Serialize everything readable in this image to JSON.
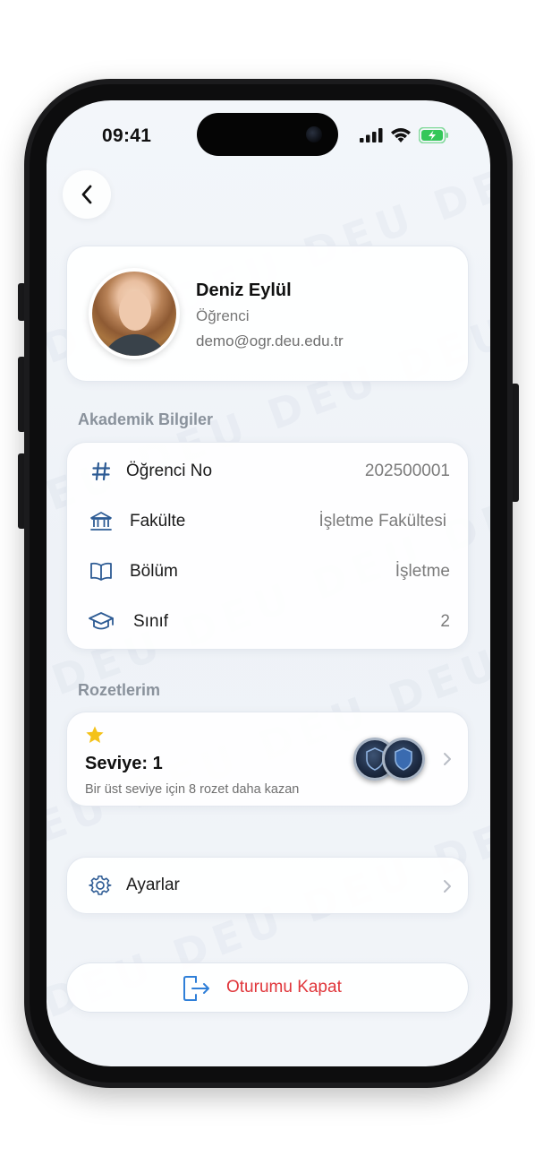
{
  "status_bar": {
    "time": "09:41"
  },
  "profile": {
    "name": "Deniz Eylül",
    "role": "Öğrenci",
    "email": "demo@ogr.deu.edu.tr"
  },
  "academic": {
    "section_title": "Akademik Bilgiler",
    "rows": [
      {
        "icon": "hash-icon",
        "label": "Öğrenci No",
        "value": "202500001"
      },
      {
        "icon": "bank-icon",
        "label": "Fakülte",
        "value": "İşletme Fakültesi"
      },
      {
        "icon": "book-icon",
        "label": "Bölüm",
        "value": "İşletme"
      },
      {
        "icon": "graduation-cap-icon",
        "label": "Sınıf",
        "value": "2"
      }
    ]
  },
  "badges": {
    "section_title": "Rozetlerim",
    "level": "Seviye: 1",
    "subtitle": "Bir üst seviye için 8 rozet daha kazan"
  },
  "settings": {
    "label": "Ayarlar"
  },
  "logout": {
    "label": "Oturumu Kapat"
  },
  "colors": {
    "accent_blue": "#2d5b94",
    "logout_red": "#e0363b",
    "star_gold": "#f4c21a",
    "battery_green": "#34c759"
  }
}
